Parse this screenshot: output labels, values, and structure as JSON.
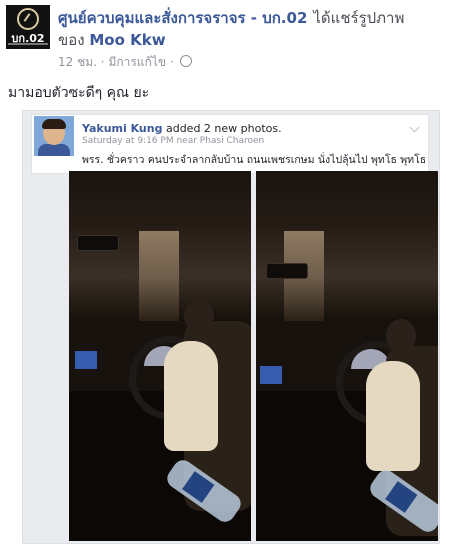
{
  "header": {
    "page_avatar_text": "บก.02",
    "page_name": "ศูนย์ควบคุมและสั่งการจราจร - บก.02",
    "action": "ได้แชร์รูปภาพ",
    "of_label": "ของ",
    "owner_name": "Moo Kkw",
    "time": "12 ชม.",
    "edited": "มีการแก้ไข",
    "separator": "·",
    "privacy_icon": "globe-icon"
  },
  "caption": "มามอบตัวซะดีๆ คุณ ยะ",
  "shared_post": {
    "user_name": "Yakumi Kung",
    "action": "added 2 new photos.",
    "time": "Saturday at 9:16 PM near Phasi Charoen",
    "text": "พรร. ชั่วคราว คนประจำลากลับบ้าน ถนนเพชรเกษม นั่งไปลุ้นไป พุทโธ พุทโธ",
    "menu_icon": "chevron-down-icon"
  },
  "photos": [
    {
      "alt": "child driving car at night photo 1"
    },
    {
      "alt": "child driving car at night photo 2"
    }
  ]
}
